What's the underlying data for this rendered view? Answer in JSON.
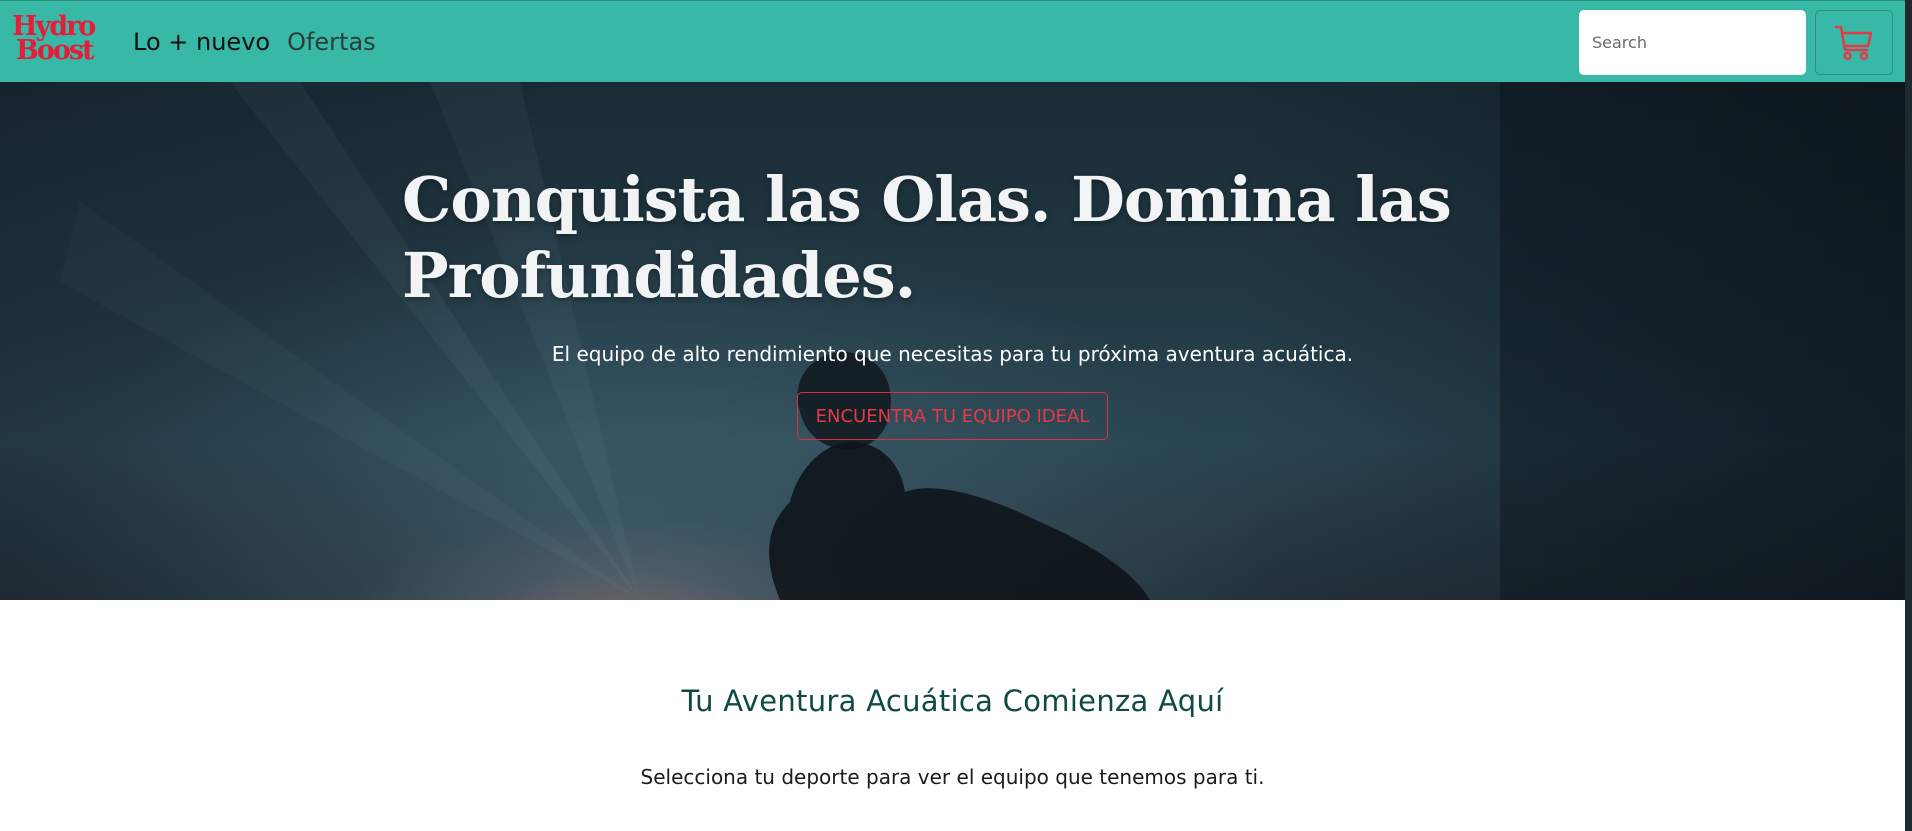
{
  "navbar": {
    "logo_line1": "Hydro",
    "logo_line2": "Boost",
    "links": [
      {
        "label": "Lo + nuevo"
      },
      {
        "label": "Ofertas"
      }
    ],
    "search_placeholder": "Search",
    "cart_icon": "cart-icon"
  },
  "hero": {
    "title": "Conquista las Olas. Domina las Profundidades.",
    "subtitle": "El equipo de alto rendimiento que necesitas para tu próxima aventura acuática.",
    "cta_label": "ENCUENTRA TU EQUIPO IDEAL"
  },
  "section": {
    "title": "Tu Aventura Acuática Comienza Aquí",
    "subtitle": "Selecciona tu deporte para ver el equipo que tenemos para ti."
  },
  "colors": {
    "navbar_bg": "#38b8a6",
    "brand_red": "#e41d3a",
    "heading_teal": "#0f4a44"
  }
}
